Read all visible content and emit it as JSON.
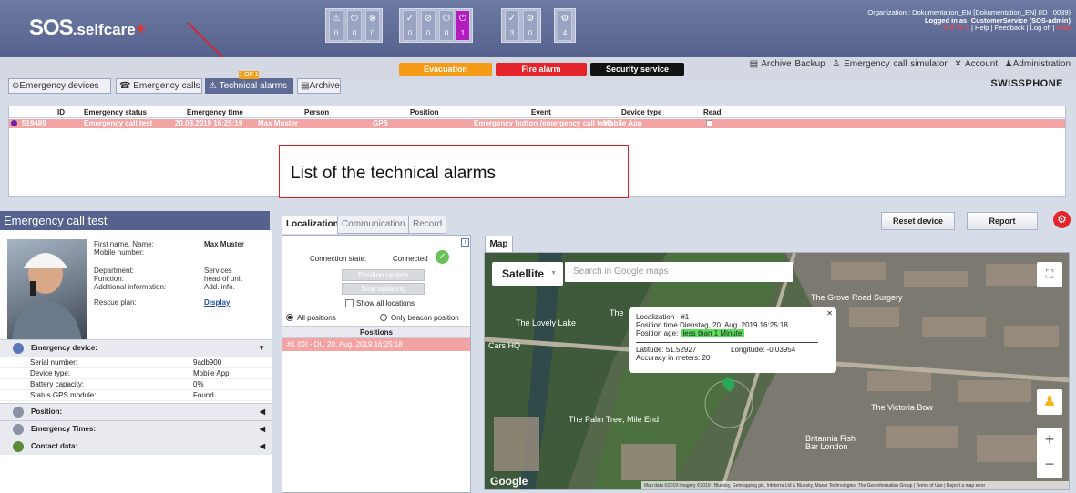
{
  "header": {
    "logo_text": "SOS",
    "logo_suffix": ".selfcare",
    "logo_plus": "+",
    "counters": [
      {
        "icon": "warning-icon",
        "value": "0"
      },
      {
        "icon": "power-icon",
        "value": "0"
      },
      {
        "icon": "warning-icon",
        "value": "0"
      },
      {
        "icon": "check-icon",
        "value": "0"
      },
      {
        "icon": "cancel-icon",
        "value": "0"
      },
      {
        "icon": "power-icon",
        "value": "0"
      },
      {
        "icon": "power-icon",
        "value": "1"
      },
      {
        "icon": "check-icon",
        "value": "3"
      },
      {
        "icon": "gear-icon",
        "value": "0"
      },
      {
        "icon": "gear-icon",
        "value": "4"
      }
    ],
    "org_line": "Organization : Dokumentation_EN [Dokumentation_EN] (ID : 0039)",
    "logged_line": "Logged in as: CustomerService (SOS-admin)",
    "links_line_red": "N E W S",
    "links_line": " | Help | Feedback | Log off | ",
    "links_line_red2": "Help"
  },
  "topmenu": {
    "archive_backup": "Archive Backup",
    "simulator": "Emergency call simulator",
    "account": "Account",
    "administration": "Administration"
  },
  "alarm_buttons": {
    "evacuation": "Evacuation",
    "fire": "Fire alarm",
    "security": "Security service"
  },
  "tabs": {
    "devices": "Emergency devices",
    "calls": "Emergency calls",
    "technical": "Technical alarms",
    "archive": "Archive",
    "badge": "1 OF 1"
  },
  "brand": "SWISSPHONE",
  "list": {
    "columns": [
      "ID",
      "Emergency status",
      "Emergency time",
      "Person",
      "Position",
      "Event",
      "Device type",
      "Read"
    ],
    "row": {
      "id": "519489",
      "status": "Emergency call test",
      "time": "20.08.2019 16:25:19",
      "person": "Max Muster",
      "position": "GPS",
      "event": "Emergency button (emergency call test)",
      "device": "Mobile App"
    }
  },
  "callout": "List of the technical alarms",
  "detail": {
    "title": "Emergency call test",
    "labels": "First name, Name:\nMobile number:",
    "name_value": "Max Muster",
    "dept_labels": "Department:\nFunction:\nAdditional information:",
    "dept_values": "Services\nhead of unit\nAdd. info.",
    "rescue_label": "Rescue plan:",
    "rescue_link": "Display",
    "sections": {
      "device": "Emergency device:",
      "position": "Position:",
      "times": "Emergency Times:",
      "contact": "Contact data:"
    },
    "device_rows": [
      {
        "label": "Serial number:",
        "value": "9adb900"
      },
      {
        "label": "Device type:",
        "value": "Mobile App"
      },
      {
        "label": "Battery capacity:",
        "value": "0%"
      },
      {
        "label": "Status GPS module:",
        "value": "Found"
      }
    ]
  },
  "center": {
    "tabs": [
      "Localization",
      "Communication",
      "Record"
    ],
    "connection_label": "Connection state:",
    "connection_value": "Connected",
    "btn_update": "Position update",
    "btn_stop": "Stop updating",
    "show_all": "Show all locations",
    "all_positions": "All positions",
    "only_beacon": "Only beacon position",
    "positions_header": "Positions",
    "position_row": "#1 (O) - Di., 20. Aug. 2019 16:25:18"
  },
  "right": {
    "reset": "Reset device",
    "report": "Report",
    "map_tab": "Map",
    "satellite": "Satellite",
    "search_placeholder": "Search in Google maps",
    "popup": {
      "title": "Localization - #1",
      "time_label": "Position time",
      "time_value": "Dienstag, 20. Aug. 2019 16:25:18",
      "age_label": "Position age:",
      "age_value": "less than 1 Minute",
      "lat": "Latitude: 51.52927",
      "lon": "Longitude: -0.03954",
      "accuracy": "Accuracy in meters: 20"
    },
    "places": [
      "The Grove Road Surgery",
      "The Lovely Lake",
      "The Palm Tree, Mile End",
      "Britannia Fish Bar London",
      "The Victoria Bow",
      "Cars HQ",
      "The"
    ],
    "google": "Google",
    "attribution": "Map data ©2019 Imagery ©2019 , Bluesky, Getmapping plc, Infoterra Ltd & Bluesky, Maxar Technologies, The GeoInformation Group | Terms of Use | Report a map error"
  }
}
